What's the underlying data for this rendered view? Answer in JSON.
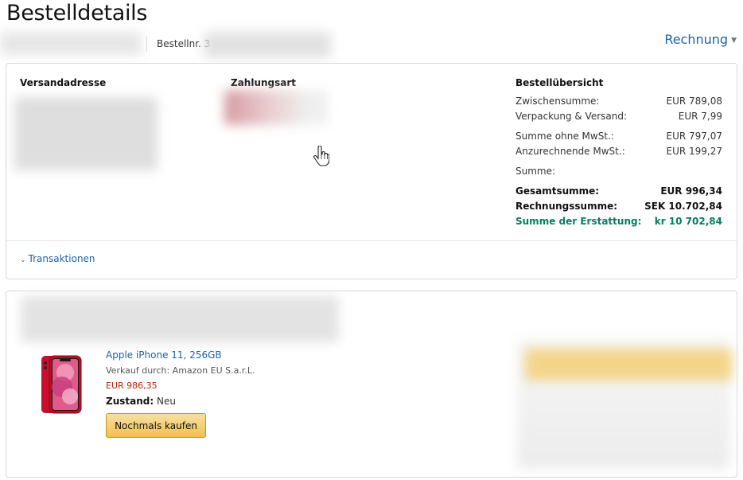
{
  "header": {
    "title": "Bestelldetails",
    "order_label": "Bestellnr. 3",
    "invoice_label": "Rechnung"
  },
  "summary_box": {
    "shipping_heading": "Versandadresse",
    "payment_heading": "Zahlungsart",
    "overview_heading": "Bestellübersicht",
    "rows": [
      {
        "label": "Zwischensumme:",
        "value": "EUR 789,08"
      },
      {
        "label": "Verpackung & Versand:",
        "value": "EUR 7,99"
      },
      {
        "label": "Summe ohne MwSt.:",
        "value": "EUR 797,07"
      },
      {
        "label": "Anzurechnende MwSt.:",
        "value": "EUR 199,27"
      },
      {
        "label": "Summe:",
        "value": ""
      },
      {
        "label": "Gesamtsumme:",
        "value": "EUR 996,34"
      },
      {
        "label": "Rechnungssumme:",
        "value": "SEK 10.702,84"
      },
      {
        "label": "Summe der Erstattung:",
        "value": "kr 10 702,84"
      }
    ],
    "transactions_label": "Transaktionen"
  },
  "product": {
    "title": "Apple iPhone 11, 256GB",
    "seller": "Verkauf durch: Amazon EU S.a.r.L.",
    "price": "EUR 986,35",
    "condition_label": "Zustand:",
    "condition_value": "Neu",
    "buy_again_label": "Nochmals kaufen"
  },
  "colors": {
    "link": "#2162a1",
    "price": "#b12704",
    "refund": "#067d62",
    "button": "#f0c14b"
  }
}
